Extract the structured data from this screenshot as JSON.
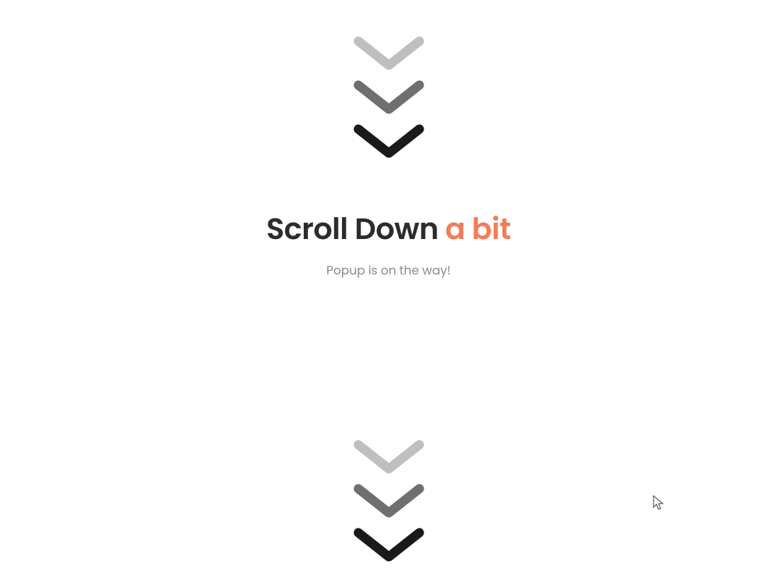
{
  "heading": {
    "main": "Scroll Down ",
    "accent": "a bit"
  },
  "subtext": "Popup is on the way!",
  "colors": {
    "accent": "#f37c5a",
    "textDark": "#2c2c2c",
    "textLight": "#8a8a8a",
    "chevron1": "#bfbfbf",
    "chevron2": "#6f6f6f",
    "chevron3": "#1a1a1a"
  }
}
